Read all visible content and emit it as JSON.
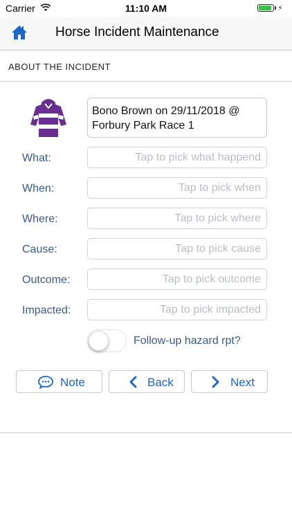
{
  "status_bar": {
    "carrier": "Carrier",
    "time": "11:10 AM",
    "wifi_icon": "wifi-icon",
    "battery_icon": "battery-charging-icon"
  },
  "nav": {
    "home_icon": "home-icon",
    "title": "Horse Incident Maintenance"
  },
  "section": {
    "title": "ABOUT THE INCIDENT"
  },
  "incident": {
    "silks_icon": "jockey-silks-icon",
    "summary": "Bono Brown on 29/11/2018 @ Forbury Park Race 1"
  },
  "fields": [
    {
      "label": "What:",
      "placeholder": "Tap to pick what happend"
    },
    {
      "label": "When:",
      "placeholder": "Tap to pick when"
    },
    {
      "label": "Where:",
      "placeholder": "Tap to pick where"
    },
    {
      "label": "Cause:",
      "placeholder": "Tap to pick cause"
    },
    {
      "label": "Outcome:",
      "placeholder": "Tap to pick outcome"
    },
    {
      "label": "Impacted:",
      "placeholder": "Tap to pick impacted"
    }
  ],
  "followup": {
    "label": "Follow-up hazard rpt?",
    "enabled": false
  },
  "buttons": {
    "note": "Note",
    "back": "Back",
    "next": "Next"
  },
  "colors": {
    "accent": "#1a66c9",
    "label": "#3a5a82",
    "placeholder": "#b9bec5",
    "silks_purple": "#6a2d91",
    "battery": "#3bc14a"
  }
}
